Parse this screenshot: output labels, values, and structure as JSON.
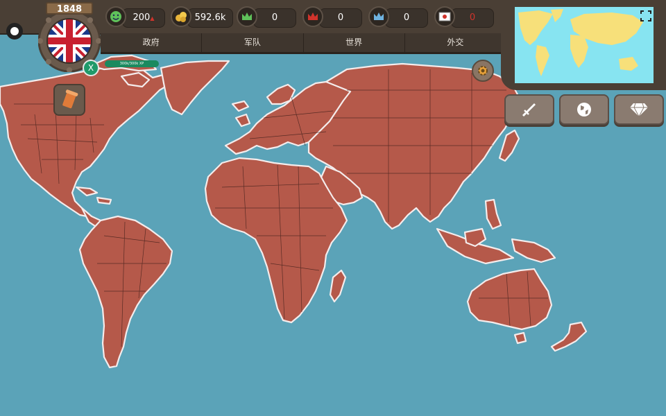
{
  "game": {
    "year": "1848"
  },
  "resources": [
    {
      "name": "stability",
      "icon": "smiley-icon",
      "value": "200",
      "suffix": "▲",
      "suffix_color": "#d0342c"
    },
    {
      "name": "gold",
      "icon": "coins-icon",
      "value": "592.6k",
      "suffix": "▲",
      "suffix_color": "#3fbf5a"
    },
    {
      "name": "green-crown",
      "icon": "green-crown-icon",
      "value": "0"
    },
    {
      "name": "red-crown",
      "icon": "red-crown-icon",
      "value": "0"
    },
    {
      "name": "blue-crown",
      "icon": "blue-crown-icon",
      "value": "0"
    },
    {
      "name": "flag-resource",
      "icon": "flag-card-icon",
      "value": "0",
      "value_color": "#d0342c"
    }
  ],
  "nav": {
    "tabs": [
      "政府",
      "军队",
      "世界",
      "外交"
    ]
  },
  "player": {
    "country_flag": "union-jack-icon",
    "xp_label": "300k/300k XP",
    "x_button": "X"
  },
  "buttons": {
    "war": "sword-icon",
    "world": "globe-icon",
    "shop": "diamond-icon",
    "settings": "gear-icon",
    "history": "scroll-icon",
    "fullscreen": "expand-icon"
  },
  "colors": {
    "ocean": "#5ba3b8",
    "land": "#b5594a",
    "minimap_ocean": "#87e4f1",
    "minimap_land": "#f7e07a",
    "frame": "#4a3f35"
  }
}
